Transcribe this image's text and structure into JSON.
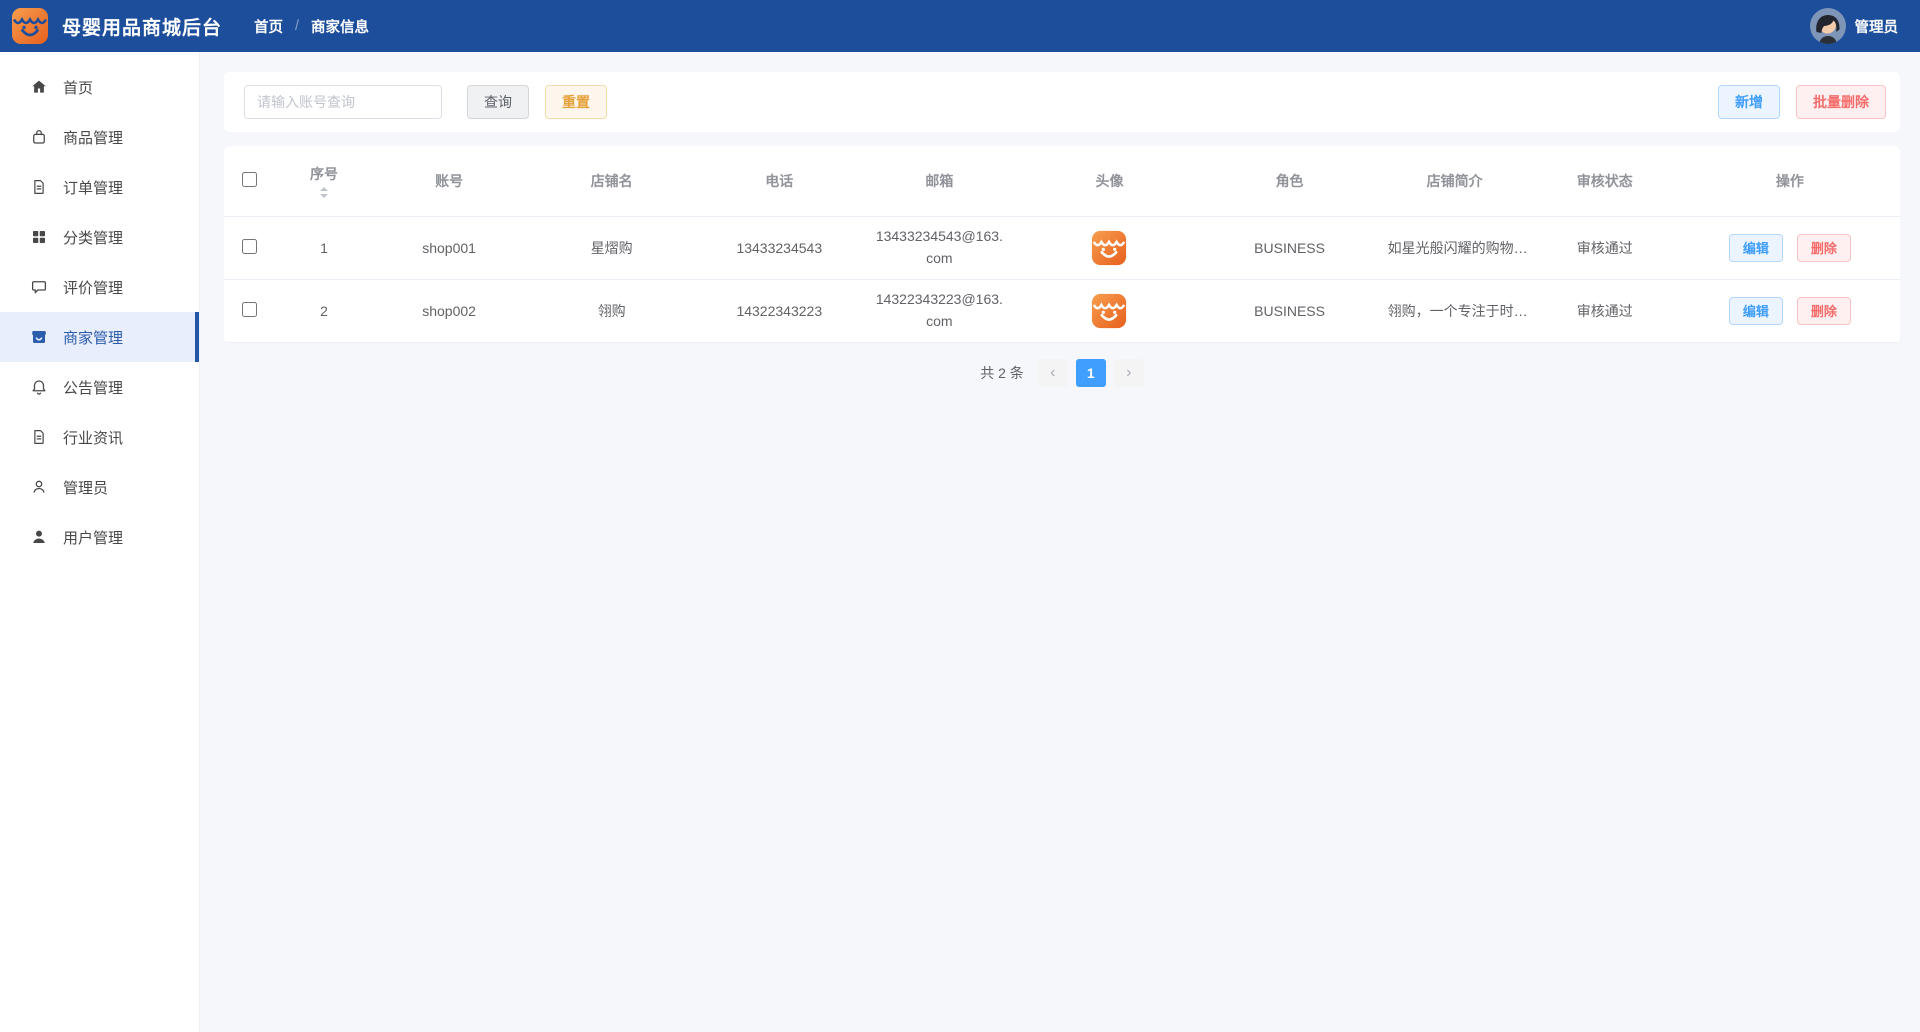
{
  "navbar": {
    "title": "母婴用品商城后台",
    "breadcrumb": [
      "首页",
      "商家信息"
    ],
    "breadcrumb_separator": "/",
    "user_label": "管理员"
  },
  "sidebar": {
    "items": [
      {
        "label": "首页",
        "icon": "home-icon",
        "active": false
      },
      {
        "label": "商品管理",
        "icon": "shopping-bag-icon",
        "active": false
      },
      {
        "label": "订单管理",
        "icon": "document-icon",
        "active": false
      },
      {
        "label": "分类管理",
        "icon": "grid-icon",
        "active": false
      },
      {
        "label": "评价管理",
        "icon": "chat-bubble-icon",
        "active": false
      },
      {
        "label": "商家管理",
        "icon": "storefront-icon",
        "active": true
      },
      {
        "label": "公告管理",
        "icon": "bell-icon",
        "active": false
      },
      {
        "label": "行业资讯",
        "icon": "news-icon",
        "active": false
      },
      {
        "label": "管理员",
        "icon": "person-outline-icon",
        "active": false
      },
      {
        "label": "用户管理",
        "icon": "person-filled-icon",
        "active": false
      }
    ]
  },
  "toolbar": {
    "search_placeholder": "请输入账号查询",
    "search_value": "",
    "query_label": "查询",
    "reset_label": "重置",
    "add_label": "新增",
    "batch_delete_label": "批量删除"
  },
  "table": {
    "columns": [
      "序号",
      "账号",
      "店铺名",
      "电话",
      "邮箱",
      "头像",
      "角色",
      "店铺简介",
      "审核状态",
      "操作"
    ],
    "rows": [
      {
        "index": "1",
        "account": "shop001",
        "shop_name": "星熠购",
        "phone": "13433234543",
        "email": "13433234543@163.com",
        "avatar": "shop-logo-icon",
        "role": "BUSINESS",
        "intro": "如星光般闪耀的购物…",
        "audit_status": "审核通过"
      },
      {
        "index": "2",
        "account": "shop002",
        "shop_name": "翎购",
        "phone": "14322343223",
        "email": "14322343223@163.com",
        "avatar": "shop-logo-icon",
        "role": "BUSINESS",
        "intro": "翎购，一个专注于时…",
        "audit_status": "审核通过"
      }
    ],
    "edit_label": "编辑",
    "delete_label": "删除"
  },
  "pagination": {
    "total_text": "共 2 条",
    "prev_icon": "‹",
    "next_icon": "›",
    "current_page": "1"
  },
  "colors": {
    "navbar_bg": "#1d4e9c",
    "brand_orange": "#ec6b25",
    "primary_blue": "#409eff",
    "danger_red": "#f56c6c",
    "warning_orange": "#e6a23c",
    "active_menu_bg": "#e8eefb",
    "content_bg": "#f5f7fa"
  }
}
